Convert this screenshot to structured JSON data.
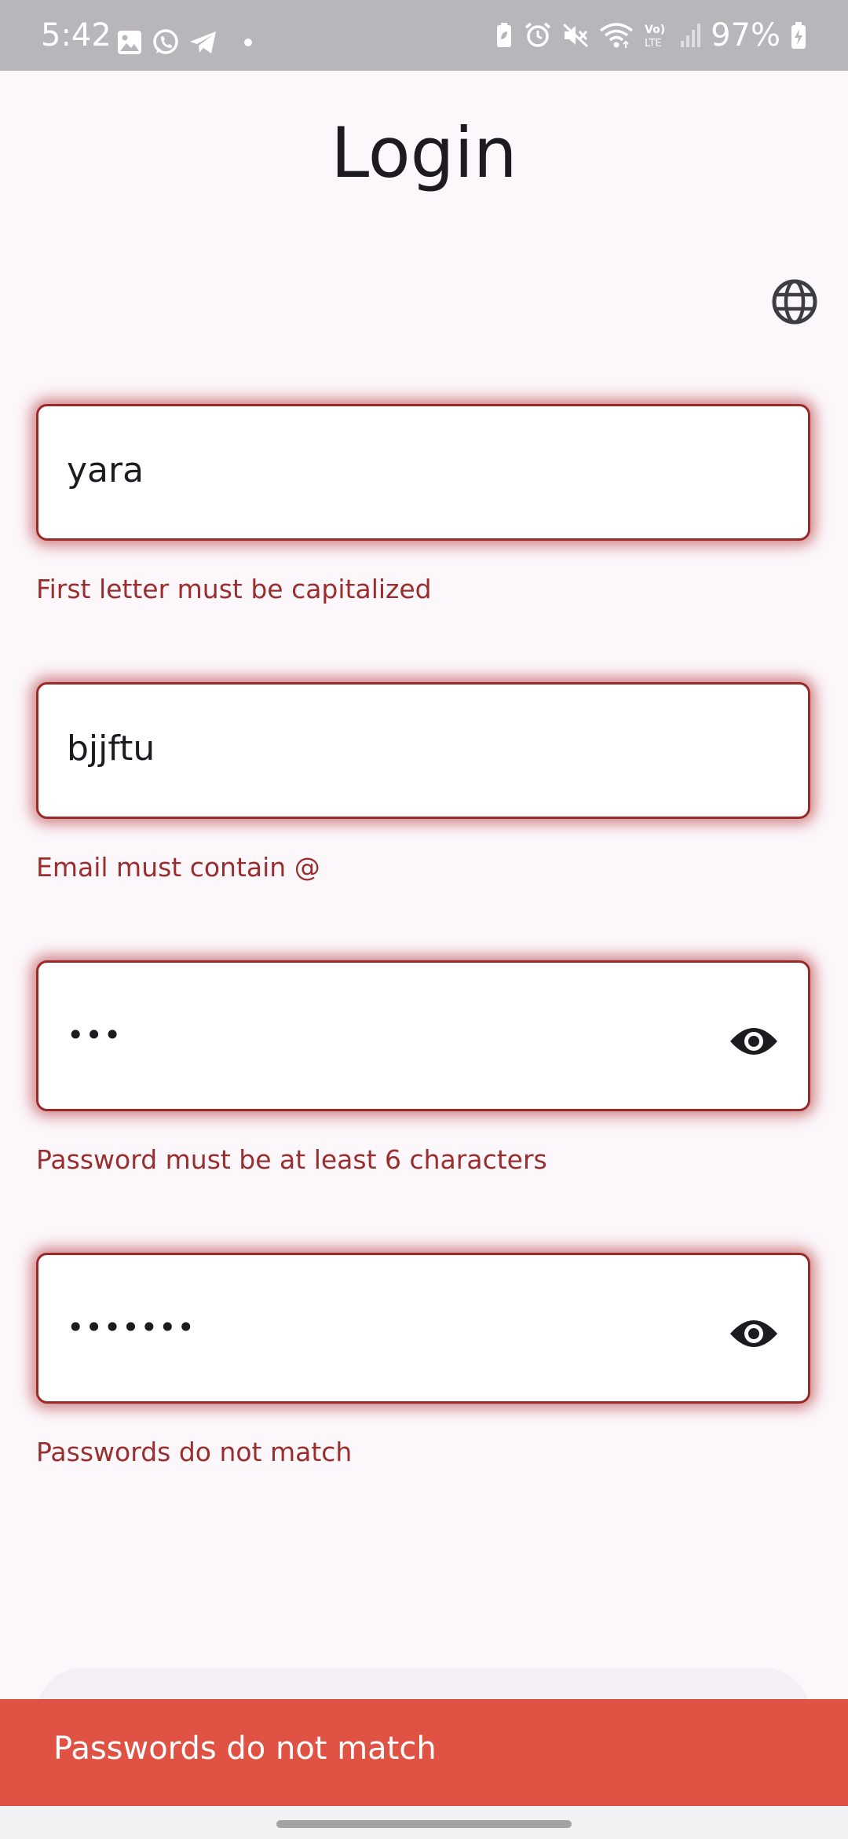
{
  "status_bar": {
    "time": "5:42",
    "battery": "97%",
    "left_icons": [
      "gallery-icon",
      "whatsapp-icon",
      "telegram-icon",
      "dot-icon"
    ],
    "right_icons": [
      "battery-saver-icon",
      "alarm-icon",
      "mute-icon",
      "wifi-icon",
      "volte-icon",
      "signal-icon",
      "battery-charging-icon"
    ]
  },
  "page": {
    "title": "Login"
  },
  "language_button": {
    "icon": "globe-icon"
  },
  "form": {
    "name": {
      "value": "yara",
      "error": "First letter must be capitalized"
    },
    "email": {
      "value": "bjjftu",
      "error": "Email must contain @"
    },
    "password": {
      "value": "•••",
      "error": "Password must be at least 6 characters",
      "toggle_icon": "eye-icon"
    },
    "confirm_password": {
      "value": "•••••••",
      "error": "Passwords do not match",
      "toggle_icon": "eye-icon"
    }
  },
  "snackbar": {
    "message": "Passwords do not match"
  },
  "colors": {
    "background": "#fcf7fb",
    "error": "#9b2d2d",
    "snackbar": "#e05244",
    "status_bar": "#b8b5bb"
  }
}
